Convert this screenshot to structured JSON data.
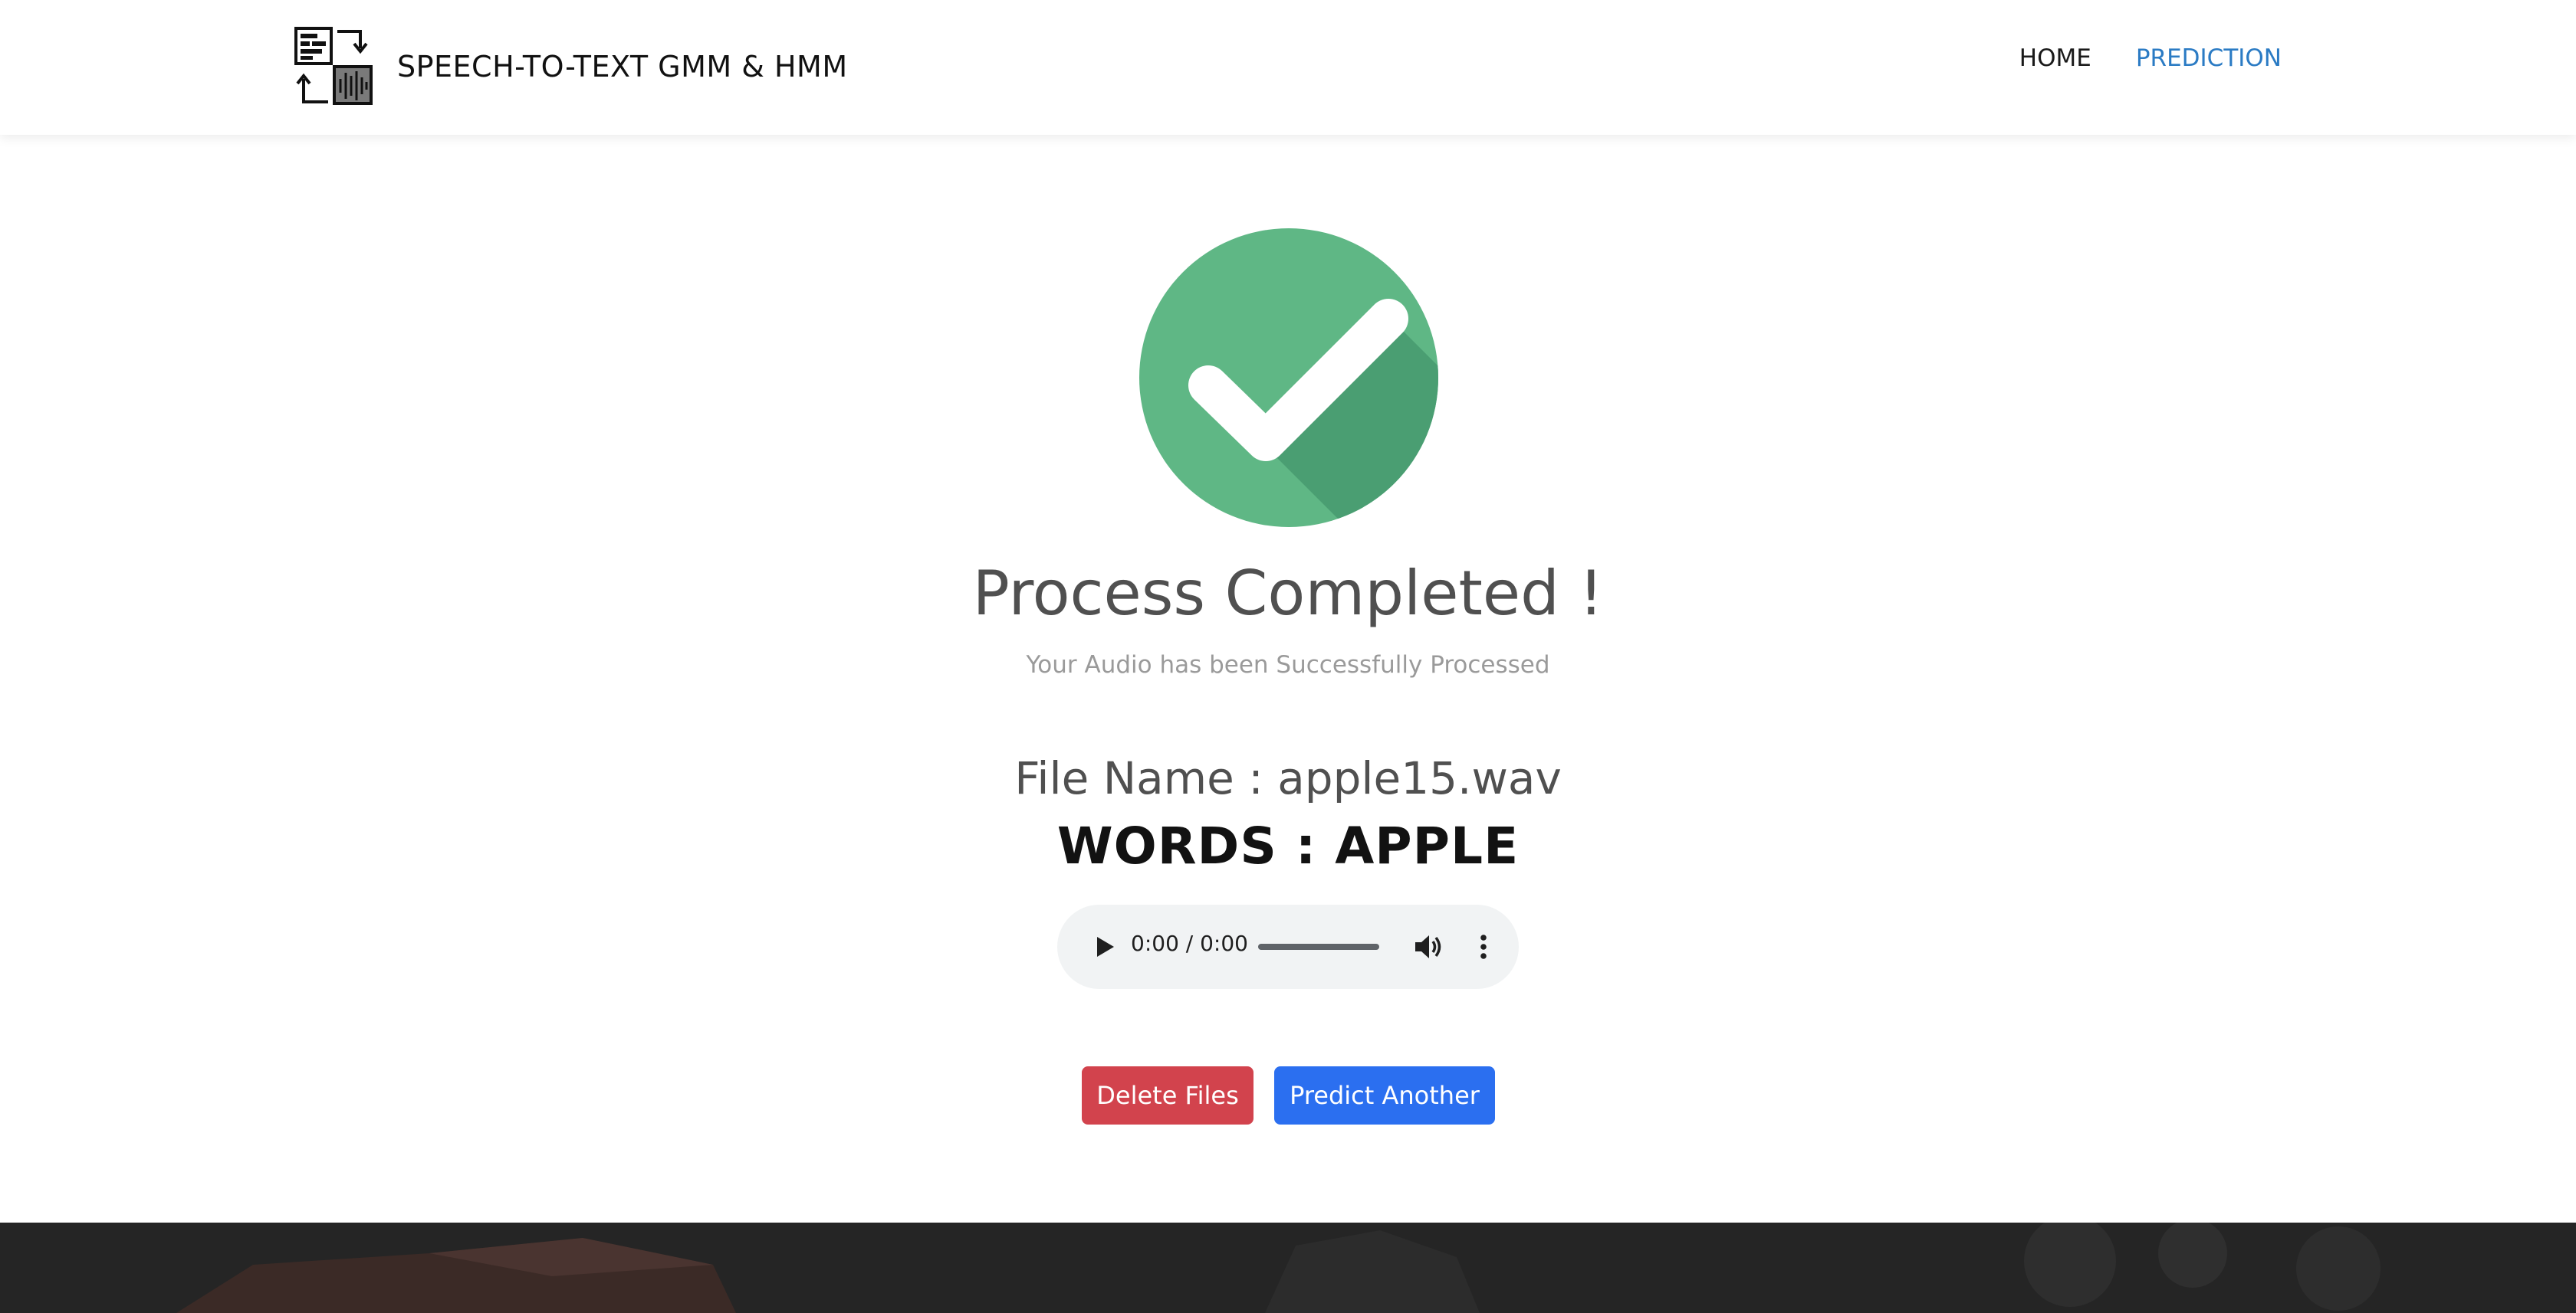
{
  "header": {
    "brand_title": "SPEECH-TO-TEXT GMM & HMM",
    "logo_icon": "speech-to-text-logo-icon",
    "nav": [
      {
        "label": "HOME",
        "active": false
      },
      {
        "label": "PREDICTION",
        "active": true
      }
    ]
  },
  "status": {
    "icon": "check-circle-icon",
    "title": "Process Completed !",
    "subtitle": "Your Audio has been Successfully Processed"
  },
  "result": {
    "file_line": "File Name : apple15.wav",
    "words_line": "WORDS : APPLE"
  },
  "audio": {
    "time": "0:00 / 0:00",
    "progress": 0
  },
  "actions": {
    "delete_label": "Delete Files",
    "predict_label": "Predict Another"
  },
  "colors": {
    "check_green": "#5fb785",
    "check_shadow": "#4a9e72",
    "delete_red": "#d2434d",
    "predict_blue": "#2b6ff0",
    "nav_active": "#2b7bc4"
  }
}
